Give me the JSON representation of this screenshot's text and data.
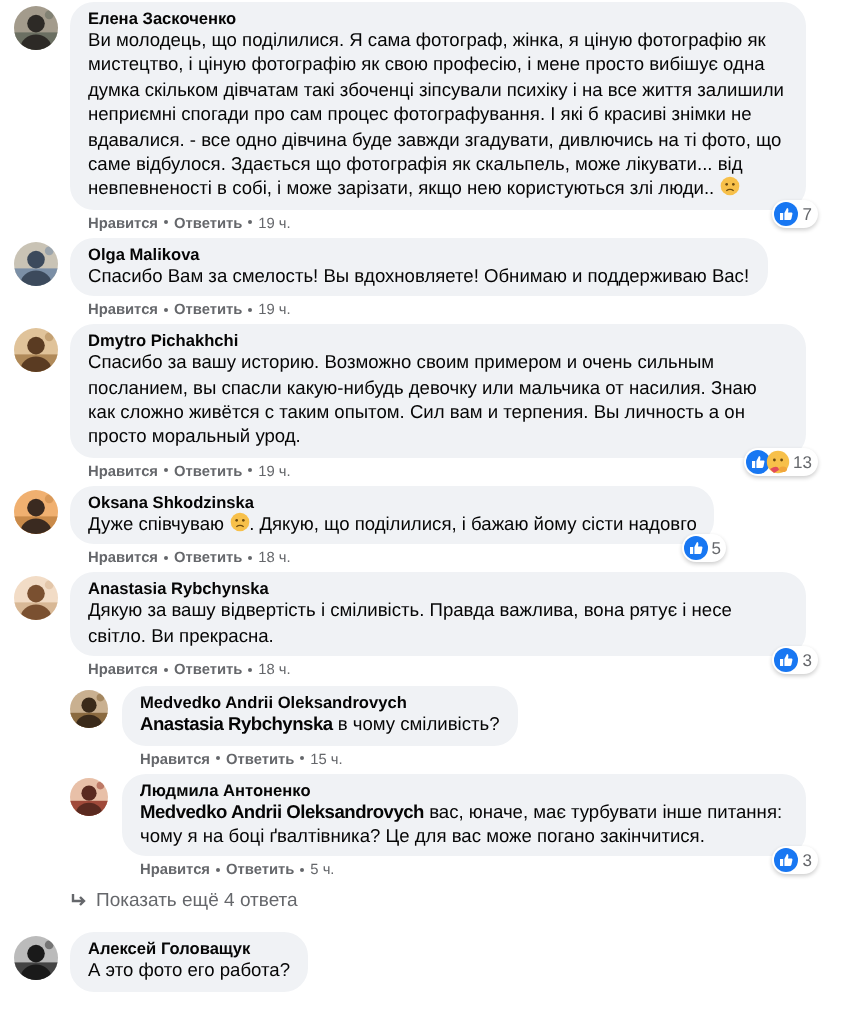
{
  "comments": [
    {
      "author": "Елена Заскоченко",
      "parts": [
        {
          "kind": "text",
          "text": "Ви молодець, що поділилися. Я сама фотограф, жінка, я ціную фотографію як мистецтво, і ціную фотографію як свою професію, і мене просто вибішує одна думка скільком дівчатам такі збоченці зіпсували психіку і на все життя залишили неприємні спогади про сам процес фотографування. І які б красиві знімки не вдавалися. - все одно дівчина буде завжди згадувати, дивлючись на ті фото, що саме відбулося. Здається що фотографія як скальпель, може лікувати... від невпевненості в собі, і може зарізати, якщо нею користуються злі люди.. "
        },
        {
          "kind": "emoji"
        }
      ],
      "meta": {
        "like": "Нравится",
        "reply": "Ответить",
        "time": "19 ч."
      },
      "reactions": {
        "like": true,
        "count": "7"
      }
    },
    {
      "author": "Olga Malikova",
      "parts": [
        {
          "kind": "text",
          "text": "Спасибо Вам за смелость! Вы вдохновляете! Обнимаю и поддерживаю Вас!"
        }
      ],
      "meta": {
        "like": "Нравится",
        "reply": "Ответить",
        "time": "19 ч."
      }
    },
    {
      "author": "Dmytro Pichakhchi",
      "parts": [
        {
          "kind": "text",
          "text": "Спасибо за вашу историю. Возможно своим примером и очень сильным посланием, вы спасли какую-нибудь девочку или мальчика от насилия. Знаю как сложно живётся с таким опытом. Сил вам и терпения. Вы личность а он просто моральный урод."
        }
      ],
      "meta": {
        "like": "Нравится",
        "reply": "Ответить",
        "time": "19 ч."
      },
      "reactions": {
        "like": true,
        "care": true,
        "count": "13"
      }
    },
    {
      "author": "Oksana Shkodzinska",
      "parts": [
        {
          "kind": "text",
          "text": "Дуже співчуваю "
        },
        {
          "kind": "emoji"
        },
        {
          "kind": "text",
          "text": ". Дякую, що поділилися, і бажаю йому сісти надовго"
        }
      ],
      "meta": {
        "like": "Нравится",
        "reply": "Ответить",
        "time": "18 ч."
      },
      "reactions": {
        "like": true,
        "count": "5"
      }
    },
    {
      "author": "Anastasia Rybchynska",
      "parts": [
        {
          "kind": "text",
          "text": "Дякую за вашу відвертість і сміливість. Правда важлива, вона рятує і несе світло. Ви прекрасна."
        }
      ],
      "meta": {
        "like": "Нравится",
        "reply": "Ответить",
        "time": "18 ч."
      },
      "reactions": {
        "like": true,
        "count": "3"
      },
      "replies": [
        {
          "author": "Medvedko Andrii Oleksandrovych",
          "parts": [
            {
              "kind": "text",
              "text": "**Anastasia Rybchynska** в чому сміливість?"
            }
          ],
          "meta": {
            "like": "Нравится",
            "reply": "Ответить",
            "time": "15 ч."
          }
        },
        {
          "author": "Людмила Антоненко",
          "parts": [
            {
              "kind": "text",
              "text": "**Medvedko Andrii Oleksandrovych** вас, юначе, має турбувати інше питання: чому я на боці ґвалтівника? Це для вас може погано закінчитися."
            }
          ],
          "meta": {
            "like": "Нравится",
            "reply": "Ответить",
            "time": "5 ч."
          },
          "reactions": {
            "like": true,
            "count": "3"
          }
        }
      ],
      "more_replies": "Показать ещё 4 ответа"
    },
    {
      "author": "Алексей Головащук",
      "parts": [
        {
          "kind": "text",
          "text": "А это фото его работа?"
        }
      ]
    }
  ]
}
